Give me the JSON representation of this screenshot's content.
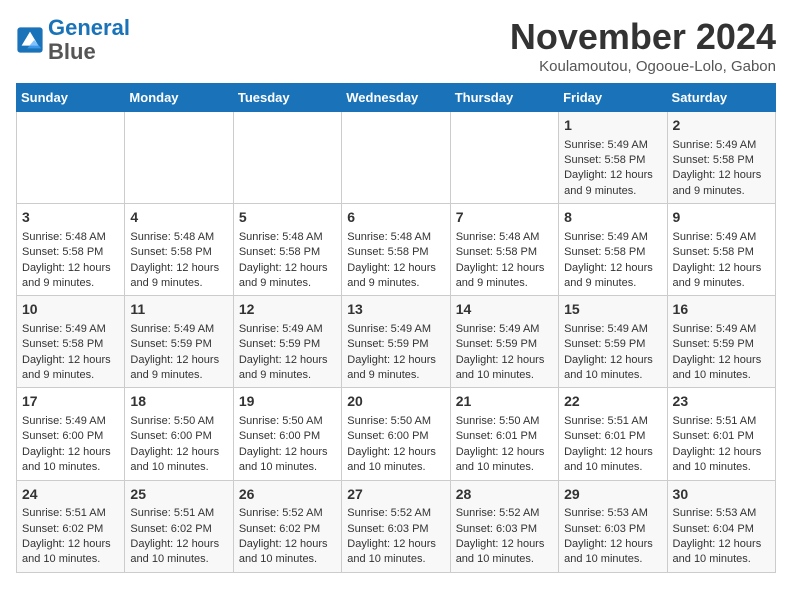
{
  "header": {
    "logo_line1": "General",
    "logo_line2": "Blue",
    "month": "November 2024",
    "location": "Koulamoutou, Ogooue-Lolo, Gabon"
  },
  "days_of_week": [
    "Sunday",
    "Monday",
    "Tuesday",
    "Wednesday",
    "Thursday",
    "Friday",
    "Saturday"
  ],
  "weeks": [
    [
      {
        "day": "",
        "content": ""
      },
      {
        "day": "",
        "content": ""
      },
      {
        "day": "",
        "content": ""
      },
      {
        "day": "",
        "content": ""
      },
      {
        "day": "",
        "content": ""
      },
      {
        "day": "1",
        "content": "Sunrise: 5:49 AM\nSunset: 5:58 PM\nDaylight: 12 hours\nand 9 minutes."
      },
      {
        "day": "2",
        "content": "Sunrise: 5:49 AM\nSunset: 5:58 PM\nDaylight: 12 hours\nand 9 minutes."
      }
    ],
    [
      {
        "day": "3",
        "content": "Sunrise: 5:48 AM\nSunset: 5:58 PM\nDaylight: 12 hours\nand 9 minutes."
      },
      {
        "day": "4",
        "content": "Sunrise: 5:48 AM\nSunset: 5:58 PM\nDaylight: 12 hours\nand 9 minutes."
      },
      {
        "day": "5",
        "content": "Sunrise: 5:48 AM\nSunset: 5:58 PM\nDaylight: 12 hours\nand 9 minutes."
      },
      {
        "day": "6",
        "content": "Sunrise: 5:48 AM\nSunset: 5:58 PM\nDaylight: 12 hours\nand 9 minutes."
      },
      {
        "day": "7",
        "content": "Sunrise: 5:48 AM\nSunset: 5:58 PM\nDaylight: 12 hours\nand 9 minutes."
      },
      {
        "day": "8",
        "content": "Sunrise: 5:49 AM\nSunset: 5:58 PM\nDaylight: 12 hours\nand 9 minutes."
      },
      {
        "day": "9",
        "content": "Sunrise: 5:49 AM\nSunset: 5:58 PM\nDaylight: 12 hours\nand 9 minutes."
      }
    ],
    [
      {
        "day": "10",
        "content": "Sunrise: 5:49 AM\nSunset: 5:58 PM\nDaylight: 12 hours\nand 9 minutes."
      },
      {
        "day": "11",
        "content": "Sunrise: 5:49 AM\nSunset: 5:59 PM\nDaylight: 12 hours\nand 9 minutes."
      },
      {
        "day": "12",
        "content": "Sunrise: 5:49 AM\nSunset: 5:59 PM\nDaylight: 12 hours\nand 9 minutes."
      },
      {
        "day": "13",
        "content": "Sunrise: 5:49 AM\nSunset: 5:59 PM\nDaylight: 12 hours\nand 9 minutes."
      },
      {
        "day": "14",
        "content": "Sunrise: 5:49 AM\nSunset: 5:59 PM\nDaylight: 12 hours\nand 10 minutes."
      },
      {
        "day": "15",
        "content": "Sunrise: 5:49 AM\nSunset: 5:59 PM\nDaylight: 12 hours\nand 10 minutes."
      },
      {
        "day": "16",
        "content": "Sunrise: 5:49 AM\nSunset: 5:59 PM\nDaylight: 12 hours\nand 10 minutes."
      }
    ],
    [
      {
        "day": "17",
        "content": "Sunrise: 5:49 AM\nSunset: 6:00 PM\nDaylight: 12 hours\nand 10 minutes."
      },
      {
        "day": "18",
        "content": "Sunrise: 5:50 AM\nSunset: 6:00 PM\nDaylight: 12 hours\nand 10 minutes."
      },
      {
        "day": "19",
        "content": "Sunrise: 5:50 AM\nSunset: 6:00 PM\nDaylight: 12 hours\nand 10 minutes."
      },
      {
        "day": "20",
        "content": "Sunrise: 5:50 AM\nSunset: 6:00 PM\nDaylight: 12 hours\nand 10 minutes."
      },
      {
        "day": "21",
        "content": "Sunrise: 5:50 AM\nSunset: 6:01 PM\nDaylight: 12 hours\nand 10 minutes."
      },
      {
        "day": "22",
        "content": "Sunrise: 5:51 AM\nSunset: 6:01 PM\nDaylight: 12 hours\nand 10 minutes."
      },
      {
        "day": "23",
        "content": "Sunrise: 5:51 AM\nSunset: 6:01 PM\nDaylight: 12 hours\nand 10 minutes."
      }
    ],
    [
      {
        "day": "24",
        "content": "Sunrise: 5:51 AM\nSunset: 6:02 PM\nDaylight: 12 hours\nand 10 minutes."
      },
      {
        "day": "25",
        "content": "Sunrise: 5:51 AM\nSunset: 6:02 PM\nDaylight: 12 hours\nand 10 minutes."
      },
      {
        "day": "26",
        "content": "Sunrise: 5:52 AM\nSunset: 6:02 PM\nDaylight: 12 hours\nand 10 minutes."
      },
      {
        "day": "27",
        "content": "Sunrise: 5:52 AM\nSunset: 6:03 PM\nDaylight: 12 hours\nand 10 minutes."
      },
      {
        "day": "28",
        "content": "Sunrise: 5:52 AM\nSunset: 6:03 PM\nDaylight: 12 hours\nand 10 minutes."
      },
      {
        "day": "29",
        "content": "Sunrise: 5:53 AM\nSunset: 6:03 PM\nDaylight: 12 hours\nand 10 minutes."
      },
      {
        "day": "30",
        "content": "Sunrise: 5:53 AM\nSunset: 6:04 PM\nDaylight: 12 hours\nand 10 minutes."
      }
    ]
  ]
}
